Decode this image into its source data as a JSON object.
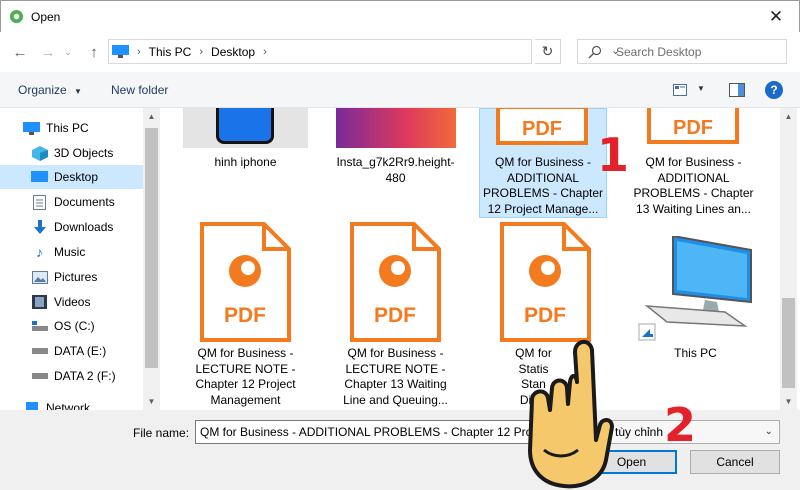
{
  "window": {
    "title": "Open"
  },
  "address": {
    "crumbs": [
      "This PC",
      "Desktop"
    ]
  },
  "search": {
    "placeholder": "Search Desktop"
  },
  "toolbar": {
    "organize": "Organize",
    "new_folder": "New folder",
    "help": "?"
  },
  "sidebar": {
    "items": [
      {
        "label": "This PC",
        "icon": "this-pc-icon"
      },
      {
        "label": "3D Objects",
        "icon": "3d-objects-icon"
      },
      {
        "label": "Desktop",
        "icon": "desktop-icon",
        "selected": true
      },
      {
        "label": "Documents",
        "icon": "documents-icon"
      },
      {
        "label": "Downloads",
        "icon": "downloads-icon"
      },
      {
        "label": "Music",
        "icon": "music-icon"
      },
      {
        "label": "Pictures",
        "icon": "pictures-icon"
      },
      {
        "label": "Videos",
        "icon": "videos-icon"
      },
      {
        "label": "OS (C:)",
        "icon": "drive-icon"
      },
      {
        "label": "DATA (E:)",
        "icon": "drive-icon"
      },
      {
        "label": "DATA 2 (F:)",
        "icon": "drive-icon"
      },
      {
        "label": "Network",
        "icon": "network-icon"
      }
    ]
  },
  "files": [
    {
      "lines": [
        "hinh iphone"
      ]
    },
    {
      "lines": [
        "Insta_g7k2Rr9.height-",
        "480"
      ]
    },
    {
      "lines": [
        "QM for Business -",
        "ADDITIONAL",
        "PROBLEMS - Chapter",
        "12 Project Manage..."
      ],
      "selected": true
    },
    {
      "lines": [
        "QM for Business -",
        "ADDITIONAL",
        "PROBLEMS - Chapter",
        "13 Waiting Lines an..."
      ]
    },
    {
      "lines": [
        "QM for Business -",
        "LECTURE NOTE -",
        "Chapter 12 Project",
        "Management"
      ]
    },
    {
      "lines": [
        "QM for Business -",
        "LECTURE NOTE -",
        "Chapter 13 Waiting",
        "Line and Queuing..."
      ]
    },
    {
      "lines": [
        "QM for",
        "Statis",
        "Stan",
        "Distri"
      ]
    },
    {
      "lines": [
        "This PC"
      ]
    }
  ],
  "pdf_label": "PDF",
  "bottom": {
    "filename_label": "File name:",
    "filename_value": "QM for Business - ADDITIONAL PROBLEMS - Chapter 12 Project M",
    "filetype_value": "tùy chỉnh",
    "open_label": "Open",
    "cancel_label": "Cancel"
  },
  "annotations": {
    "step1": "1",
    "step2": "2"
  },
  "colors": {
    "accent": "#0078d7",
    "pdf_orange": "#f47a20",
    "annotation_red": "#e3212a",
    "selection": "#cce8ff"
  }
}
